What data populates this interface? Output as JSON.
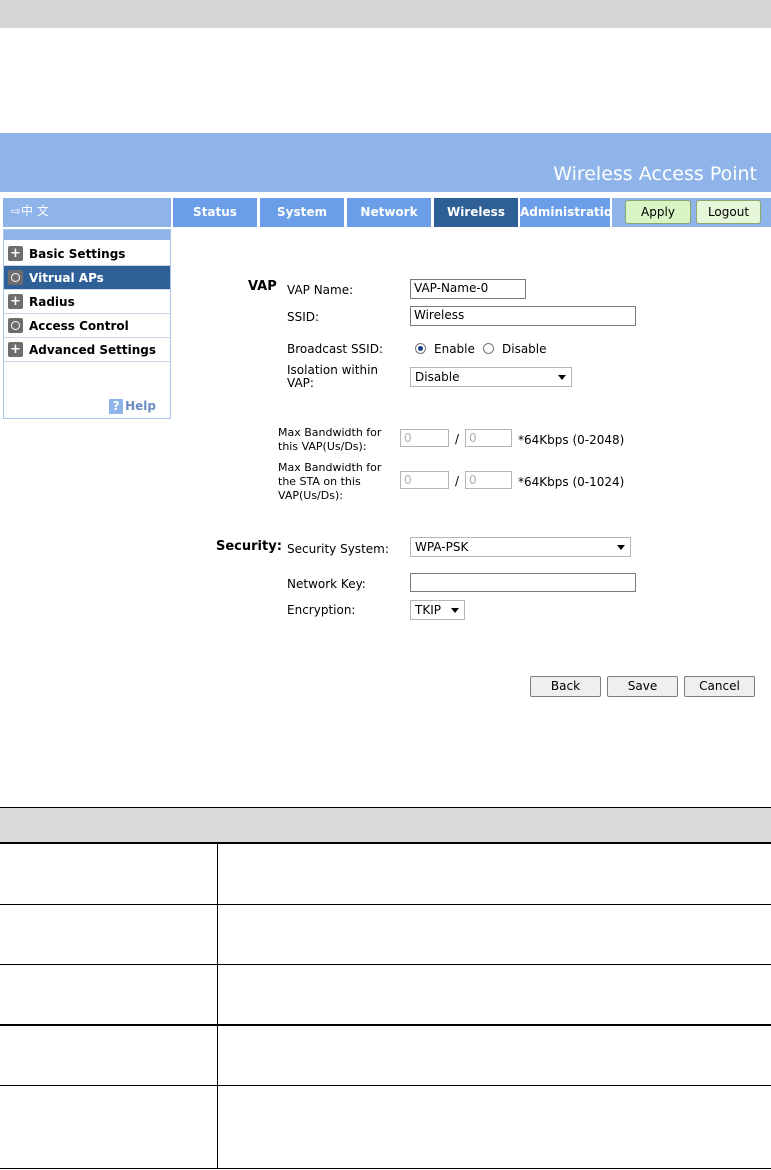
{
  "header": {
    "title": "Wireless Access Point",
    "language_link": "⇨中 文"
  },
  "nav": {
    "tabs": [
      {
        "label": "Status"
      },
      {
        "label": "System"
      },
      {
        "label": "Network"
      },
      {
        "label": "Wireless",
        "active": true
      },
      {
        "label": "Administration"
      }
    ],
    "apply_label": "Apply",
    "logout_label": "Logout"
  },
  "sidebar": {
    "items": [
      {
        "label": "Basic Settings",
        "icon": "plus-icon"
      },
      {
        "label": "Vitrual APs",
        "icon": "circle-icon",
        "active": true
      },
      {
        "label": "Radius",
        "icon": "plus-icon"
      },
      {
        "label": "Access Control",
        "icon": "circle-icon"
      },
      {
        "label": "Advanced Settings",
        "icon": "plus-icon"
      }
    ],
    "help_label": "Help",
    "help_icon": "?"
  },
  "vap": {
    "section_label": "VAP",
    "name_label": "VAP Name:",
    "name_value": "VAP-Name-0",
    "ssid_label": "SSID:",
    "ssid_value": "Wireless",
    "broadcast_label": "Broadcast SSID:",
    "enable_label": "Enable",
    "disable_label": "Disable",
    "broadcast_selected": "Enable",
    "isolation_label_1": "Isolation within",
    "isolation_label_2": "VAP:",
    "isolation_value": "Disable",
    "max_bw_vap_label_1": "Max Bandwidth for",
    "max_bw_vap_label_2": "this VAP(Us/Ds):",
    "max_bw_vap_us": "0",
    "max_bw_vap_ds": "0",
    "max_bw_vap_unit": "*64Kbps (0-2048)",
    "max_bw_sta_label_1": "Max Bandwidth for",
    "max_bw_sta_label_2": "the STA on this",
    "max_bw_sta_label_3": "VAP(Us/Ds):",
    "max_bw_sta_us": "0",
    "max_bw_sta_ds": "0",
    "max_bw_sta_unit": "*64Kbps (0-1024)",
    "slash": "/"
  },
  "security": {
    "section_label": "Security:",
    "system_label": "Security System:",
    "system_value": "WPA-PSK",
    "key_label": "Network Key:",
    "key_value": "",
    "encryption_label": "Encryption:",
    "encryption_value": "TKIP"
  },
  "actions": {
    "back_label": "Back",
    "save_label": "Save",
    "cancel_label": "Cancel"
  },
  "colors": {
    "banner": "#8eb4ea",
    "tab": "#6a9ee8",
    "tab_active": "#2f5f97",
    "apply_bg": "#d9f5c6"
  }
}
